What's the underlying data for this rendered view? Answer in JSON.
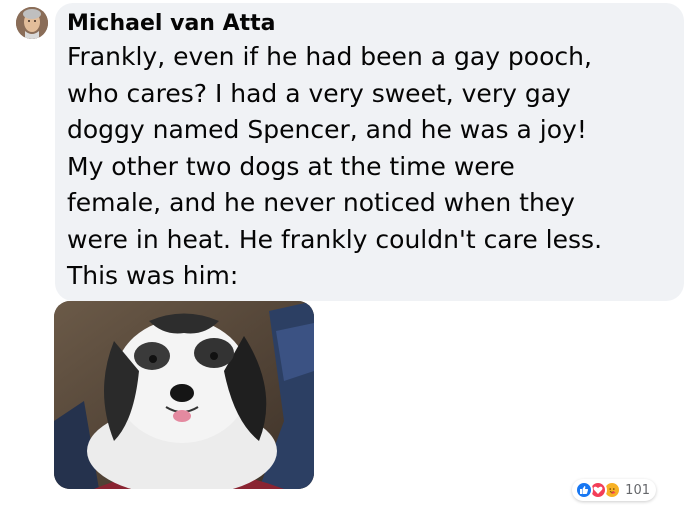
{
  "comment": {
    "author": "Michael van Atta",
    "text": "Frankly, even if he had been a gay pooch,\nwho cares? I had a very sweet, very gay\ndoggy named Spencer, and he was a joy!\nMy other two dogs at the time were\nfemale, and he never noticed when they\nwere in heat. He frankly couldn't care less.\nThis was him:"
  },
  "attachment": {
    "icon": "dog-photo"
  },
  "reactions": {
    "types": [
      "like-icon",
      "love-icon",
      "care-icon"
    ],
    "count": "101",
    "colors": {
      "like": "#1877f2",
      "love": "#f33e58",
      "care": "#f7b125"
    }
  },
  "colors": {
    "bubble_bg": "#f0f2f5",
    "text": "#050505",
    "secondary_text": "#65676b"
  }
}
